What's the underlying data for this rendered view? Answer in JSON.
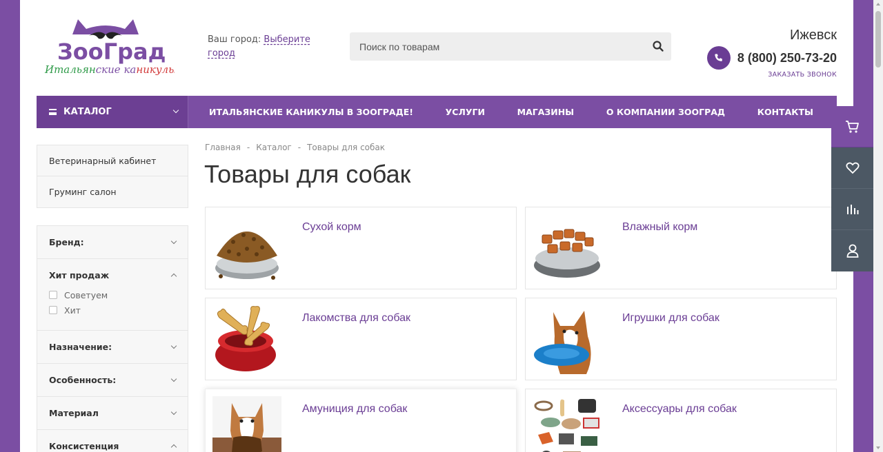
{
  "header": {
    "logo_text": "ЗооГрад",
    "logo_tagline": "Итальянские каникулы!",
    "city_label": "Ваш город:",
    "city_link": "Выберите город",
    "search_placeholder": "Поиск по товарам",
    "town": "Ижевск",
    "phone": "8 (800) 250-73-20",
    "callback": "ЗАКАЗАТЬ ЗВОНОК"
  },
  "nav": {
    "catalog": "КАТАЛОГ",
    "links": [
      "ИТАЛЬЯНСКИЕ КАНИКУЛЫ В ЗООГРАДЕ!",
      "УСЛУГИ",
      "МАГАЗИНЫ",
      "О КОМПАНИИ ЗООГРАД",
      "КОНТАКТЫ"
    ]
  },
  "sidebar": {
    "menu": [
      "Ветеринарный кабинет",
      "Груминг салон"
    ],
    "filters": [
      {
        "title": "Бренд:",
        "open": false
      },
      {
        "title": "Хит продаж",
        "open": true,
        "options": [
          "Советуем",
          "Хит"
        ]
      },
      {
        "title": "Назначение:",
        "open": false
      },
      {
        "title": "Особенность:",
        "open": false
      },
      {
        "title": "Материал",
        "open": false
      },
      {
        "title": "Консистенция",
        "open": true
      }
    ]
  },
  "breadcrumb": [
    "Главная",
    "Каталог",
    "Товары для собак"
  ],
  "page_title": "Товары для собак",
  "categories": [
    {
      "name": "Сухой корм",
      "image": "dry-food-bowl"
    },
    {
      "name": "Влажный корм",
      "image": "wet-food-bowl"
    },
    {
      "name": "Лакомства для собак",
      "image": "treats-bowl"
    },
    {
      "name": "Игрушки для собак",
      "image": "dog-with-frisbee"
    },
    {
      "name": "Амуниция для собак",
      "image": "dog-with-leash"
    },
    {
      "name": "Аксессуары для собак",
      "image": "accessories-set"
    }
  ],
  "colors": {
    "brand": "#7b4ea3",
    "link": "#6a3d94",
    "widget_gray": "#4c5864"
  }
}
